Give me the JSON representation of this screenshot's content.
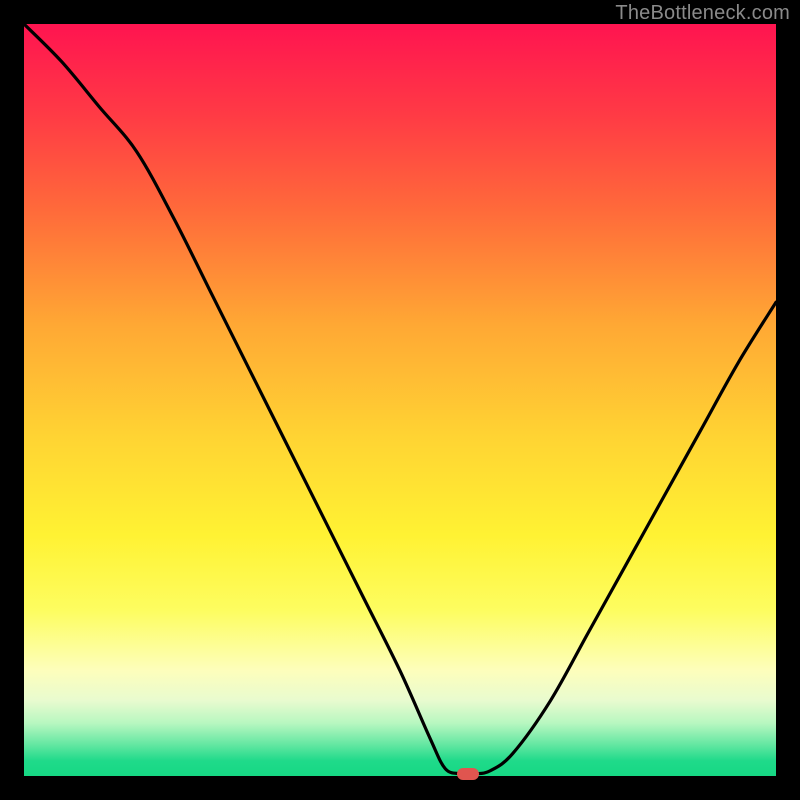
{
  "watermark": "TheBottleneck.com",
  "colors": {
    "frame": "#000000",
    "curve": "#000000",
    "marker": "#e0554f"
  },
  "chart_data": {
    "type": "line",
    "title": "",
    "xlabel": "",
    "ylabel": "",
    "xlim": [
      0,
      100
    ],
    "ylim": [
      0,
      100
    ],
    "grid": false,
    "legend": false,
    "series": [
      {
        "name": "bottleneck-curve",
        "x": [
          0,
          5,
          10,
          15,
          20,
          25,
          30,
          35,
          40,
          45,
          50,
          54,
          56,
          58,
          60,
          62,
          65,
          70,
          75,
          80,
          85,
          90,
          95,
          100
        ],
        "y": [
          100,
          95,
          89,
          83,
          74,
          64,
          54,
          44,
          34,
          24,
          14,
          5,
          1,
          0.3,
          0.3,
          0.7,
          3,
          10,
          19,
          28,
          37,
          46,
          55,
          63
        ]
      }
    ],
    "marker": {
      "x": 59,
      "y": 0.3
    },
    "gradient_note": "background encodes bottleneck severity: red high, green low"
  }
}
